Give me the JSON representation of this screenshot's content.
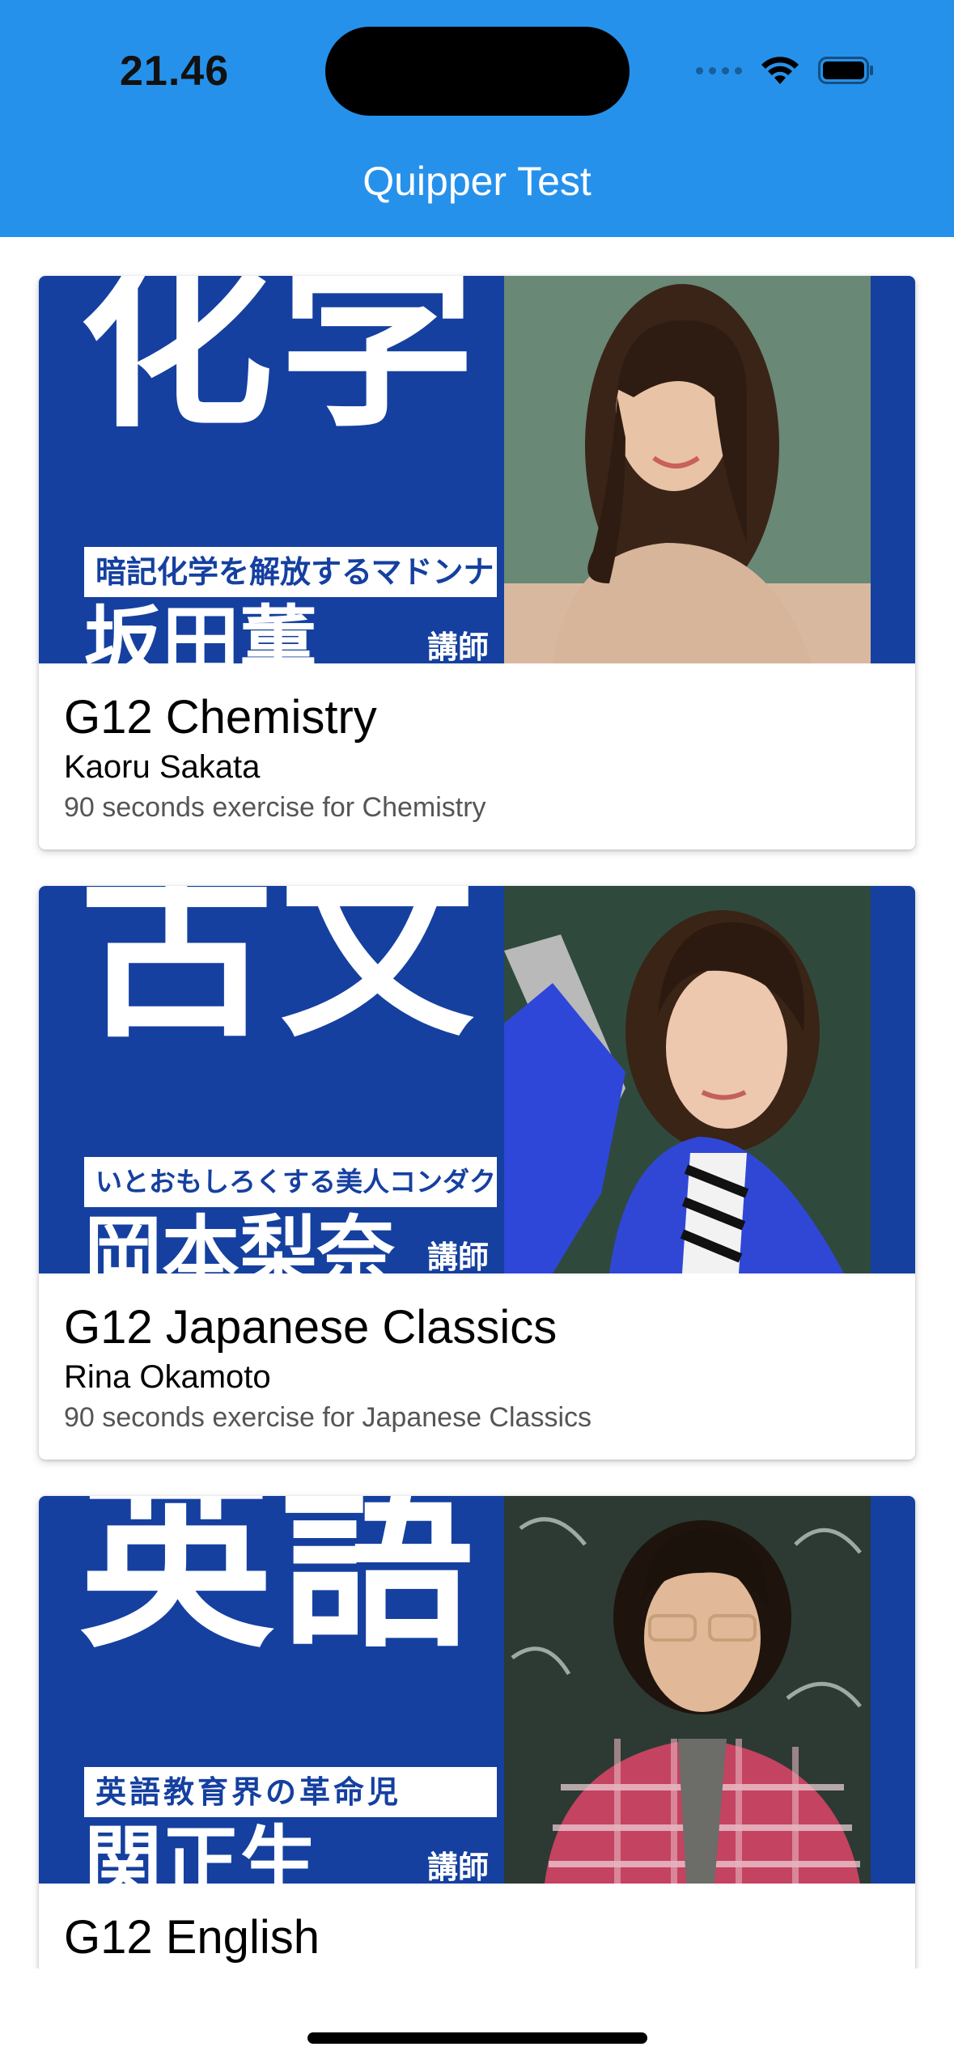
{
  "status_bar": {
    "time": "21.46",
    "icons": [
      "signal-dots-icon",
      "wifi-icon",
      "battery-icon"
    ]
  },
  "nav": {
    "title": "Quipper Test"
  },
  "colors": {
    "app_bar": "#2691EB",
    "thumbnail_blue": "#1540A0",
    "background": "#FFFFFF"
  },
  "courses": [
    {
      "title": "G12 Chemistry",
      "teacher": "Kaoru Sakata",
      "description": "90 seconds exercise for Chemistry",
      "thumbnail": {
        "subject_kanji": "化学",
        "tagline": "暗記化学を解放するマドンナ",
        "teacher_jp": "坂田薫",
        "suffix": "講師"
      }
    },
    {
      "title": "G12 Japanese Classics",
      "teacher": "Rina Okamoto",
      "description": "90 seconds exercise for Japanese Classics",
      "thumbnail": {
        "subject_kanji": "古文",
        "tagline": "いとおもしろくする美人コンダクター",
        "teacher_jp": "岡本梨奈",
        "suffix": "講師"
      }
    },
    {
      "title": "G12 English",
      "teacher": "",
      "description": "",
      "thumbnail": {
        "subject_kanji": "英語",
        "tagline": "英語教育界の革命児",
        "teacher_jp": "関正生",
        "suffix": "講師"
      }
    }
  ]
}
